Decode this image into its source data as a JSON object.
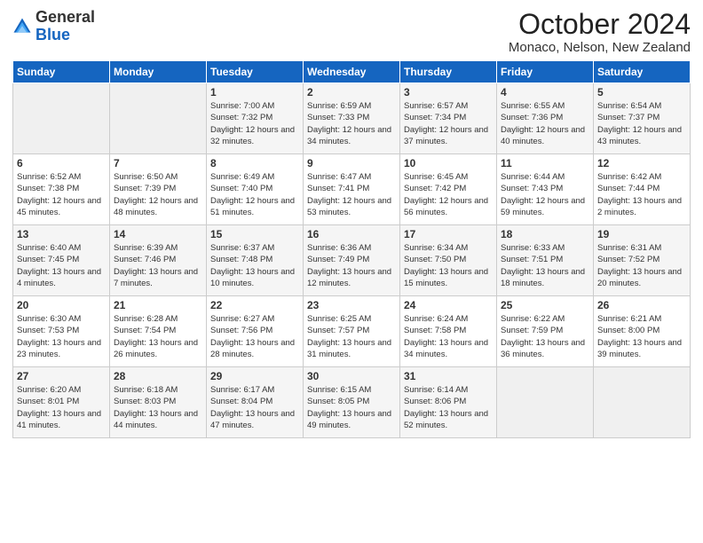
{
  "header": {
    "logo": {
      "line1": "General",
      "line2": "Blue"
    },
    "title": "October 2024",
    "location": "Monaco, Nelson, New Zealand"
  },
  "days_of_week": [
    "Sunday",
    "Monday",
    "Tuesday",
    "Wednesday",
    "Thursday",
    "Friday",
    "Saturday"
  ],
  "weeks": [
    [
      {
        "day": "",
        "info": ""
      },
      {
        "day": "",
        "info": ""
      },
      {
        "day": "1",
        "sunrise": "Sunrise: 7:00 AM",
        "sunset": "Sunset: 7:32 PM",
        "daylight": "Daylight: 12 hours and 32 minutes."
      },
      {
        "day": "2",
        "sunrise": "Sunrise: 6:59 AM",
        "sunset": "Sunset: 7:33 PM",
        "daylight": "Daylight: 12 hours and 34 minutes."
      },
      {
        "day": "3",
        "sunrise": "Sunrise: 6:57 AM",
        "sunset": "Sunset: 7:34 PM",
        "daylight": "Daylight: 12 hours and 37 minutes."
      },
      {
        "day": "4",
        "sunrise": "Sunrise: 6:55 AM",
        "sunset": "Sunset: 7:36 PM",
        "daylight": "Daylight: 12 hours and 40 minutes."
      },
      {
        "day": "5",
        "sunrise": "Sunrise: 6:54 AM",
        "sunset": "Sunset: 7:37 PM",
        "daylight": "Daylight: 12 hours and 43 minutes."
      }
    ],
    [
      {
        "day": "6",
        "sunrise": "Sunrise: 6:52 AM",
        "sunset": "Sunset: 7:38 PM",
        "daylight": "Daylight: 12 hours and 45 minutes."
      },
      {
        "day": "7",
        "sunrise": "Sunrise: 6:50 AM",
        "sunset": "Sunset: 7:39 PM",
        "daylight": "Daylight: 12 hours and 48 minutes."
      },
      {
        "day": "8",
        "sunrise": "Sunrise: 6:49 AM",
        "sunset": "Sunset: 7:40 PM",
        "daylight": "Daylight: 12 hours and 51 minutes."
      },
      {
        "day": "9",
        "sunrise": "Sunrise: 6:47 AM",
        "sunset": "Sunset: 7:41 PM",
        "daylight": "Daylight: 12 hours and 53 minutes."
      },
      {
        "day": "10",
        "sunrise": "Sunrise: 6:45 AM",
        "sunset": "Sunset: 7:42 PM",
        "daylight": "Daylight: 12 hours and 56 minutes."
      },
      {
        "day": "11",
        "sunrise": "Sunrise: 6:44 AM",
        "sunset": "Sunset: 7:43 PM",
        "daylight": "Daylight: 12 hours and 59 minutes."
      },
      {
        "day": "12",
        "sunrise": "Sunrise: 6:42 AM",
        "sunset": "Sunset: 7:44 PM",
        "daylight": "Daylight: 13 hours and 2 minutes."
      }
    ],
    [
      {
        "day": "13",
        "sunrise": "Sunrise: 6:40 AM",
        "sunset": "Sunset: 7:45 PM",
        "daylight": "Daylight: 13 hours and 4 minutes."
      },
      {
        "day": "14",
        "sunrise": "Sunrise: 6:39 AM",
        "sunset": "Sunset: 7:46 PM",
        "daylight": "Daylight: 13 hours and 7 minutes."
      },
      {
        "day": "15",
        "sunrise": "Sunrise: 6:37 AM",
        "sunset": "Sunset: 7:48 PM",
        "daylight": "Daylight: 13 hours and 10 minutes."
      },
      {
        "day": "16",
        "sunrise": "Sunrise: 6:36 AM",
        "sunset": "Sunset: 7:49 PM",
        "daylight": "Daylight: 13 hours and 12 minutes."
      },
      {
        "day": "17",
        "sunrise": "Sunrise: 6:34 AM",
        "sunset": "Sunset: 7:50 PM",
        "daylight": "Daylight: 13 hours and 15 minutes."
      },
      {
        "day": "18",
        "sunrise": "Sunrise: 6:33 AM",
        "sunset": "Sunset: 7:51 PM",
        "daylight": "Daylight: 13 hours and 18 minutes."
      },
      {
        "day": "19",
        "sunrise": "Sunrise: 6:31 AM",
        "sunset": "Sunset: 7:52 PM",
        "daylight": "Daylight: 13 hours and 20 minutes."
      }
    ],
    [
      {
        "day": "20",
        "sunrise": "Sunrise: 6:30 AM",
        "sunset": "Sunset: 7:53 PM",
        "daylight": "Daylight: 13 hours and 23 minutes."
      },
      {
        "day": "21",
        "sunrise": "Sunrise: 6:28 AM",
        "sunset": "Sunset: 7:54 PM",
        "daylight": "Daylight: 13 hours and 26 minutes."
      },
      {
        "day": "22",
        "sunrise": "Sunrise: 6:27 AM",
        "sunset": "Sunset: 7:56 PM",
        "daylight": "Daylight: 13 hours and 28 minutes."
      },
      {
        "day": "23",
        "sunrise": "Sunrise: 6:25 AM",
        "sunset": "Sunset: 7:57 PM",
        "daylight": "Daylight: 13 hours and 31 minutes."
      },
      {
        "day": "24",
        "sunrise": "Sunrise: 6:24 AM",
        "sunset": "Sunset: 7:58 PM",
        "daylight": "Daylight: 13 hours and 34 minutes."
      },
      {
        "day": "25",
        "sunrise": "Sunrise: 6:22 AM",
        "sunset": "Sunset: 7:59 PM",
        "daylight": "Daylight: 13 hours and 36 minutes."
      },
      {
        "day": "26",
        "sunrise": "Sunrise: 6:21 AM",
        "sunset": "Sunset: 8:00 PM",
        "daylight": "Daylight: 13 hours and 39 minutes."
      }
    ],
    [
      {
        "day": "27",
        "sunrise": "Sunrise: 6:20 AM",
        "sunset": "Sunset: 8:01 PM",
        "daylight": "Daylight: 13 hours and 41 minutes."
      },
      {
        "day": "28",
        "sunrise": "Sunrise: 6:18 AM",
        "sunset": "Sunset: 8:03 PM",
        "daylight": "Daylight: 13 hours and 44 minutes."
      },
      {
        "day": "29",
        "sunrise": "Sunrise: 6:17 AM",
        "sunset": "Sunset: 8:04 PM",
        "daylight": "Daylight: 13 hours and 47 minutes."
      },
      {
        "day": "30",
        "sunrise": "Sunrise: 6:15 AM",
        "sunset": "Sunset: 8:05 PM",
        "daylight": "Daylight: 13 hours and 49 minutes."
      },
      {
        "day": "31",
        "sunrise": "Sunrise: 6:14 AM",
        "sunset": "Sunset: 8:06 PM",
        "daylight": "Daylight: 13 hours and 52 minutes."
      },
      {
        "day": "",
        "info": ""
      },
      {
        "day": "",
        "info": ""
      }
    ]
  ]
}
